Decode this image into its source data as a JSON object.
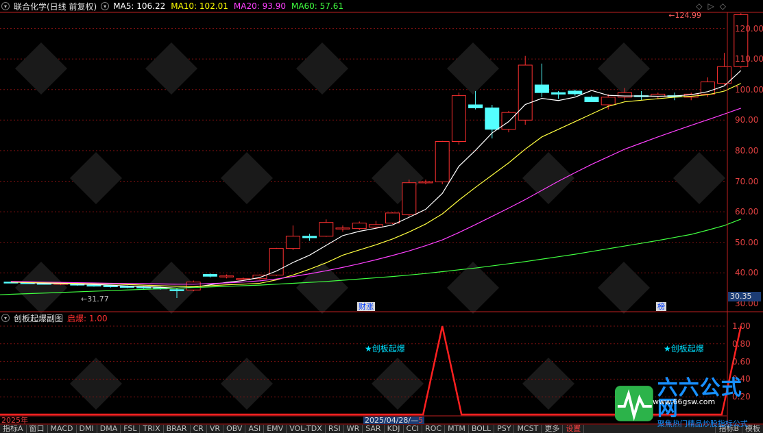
{
  "header": {
    "stock_title": "联合化学(日线 前复权)",
    "ma": [
      {
        "label": "MA5: 106.22",
        "color": "#ffffff"
      },
      {
        "label": "MA10: 102.01",
        "color": "#ffff00"
      },
      {
        "label": "MA20: 93.90",
        "color": "#ff40ff"
      },
      {
        "label": "MA60: 57.61",
        "color": "#40ff40"
      }
    ]
  },
  "controls": {
    "expand": "◇",
    "prev": "▷",
    "settings": "◇"
  },
  "price_axis": {
    "ticks": [
      "120.00",
      "110.00",
      "100.00",
      "90.00",
      "80.00",
      "70.00",
      "60.00",
      "50.00",
      "40.00",
      "30.00"
    ]
  },
  "last_price_label": "124.99",
  "low_price_label": "31.77",
  "current_price": "30.35",
  "event_tags": [
    {
      "label": "财涨"
    },
    {
      "label": "榜"
    }
  ],
  "sub": {
    "title": "创板起爆副图",
    "legend": "启爆: 1.00",
    "ticks": [
      "1.00",
      "0.80",
      "0.60",
      "0.40",
      "0.20"
    ],
    "signal_text": "★创板起爆"
  },
  "date_bar": {
    "year": "2025年",
    "cursor_date": "2025/04/28/—",
    "cursor_suffix": "5"
  },
  "tabs": [
    "指标A",
    "窗口",
    "MACD",
    "DMI",
    "DMA",
    "FSL",
    "TRIX",
    "BRAR",
    "CR",
    "VR",
    "OBV",
    "ASI",
    "EMV",
    "VOL-TDX",
    "RSI",
    "WR",
    "SAR",
    "KDJ",
    "CCI",
    "ROC",
    "MTM",
    "BOLL",
    "PSY",
    "MCST",
    "更多",
    "设置"
  ],
  "tabs_right": [
    "指标B",
    "模板"
  ],
  "logo": {
    "name": "六六公式网",
    "slogan": "聚焦热门精品炒股指标公式",
    "url": "www.66gsw.com"
  },
  "chart_data": {
    "type": "candlestick",
    "candles": [
      [
        37.0,
        37.2,
        36.6,
        36.8
      ],
      [
        36.8,
        37.0,
        36.4,
        36.6
      ],
      [
        36.6,
        36.8,
        36.2,
        36.4
      ],
      [
        36.4,
        36.8,
        36.0,
        36.6
      ],
      [
        36.6,
        36.7,
        35.8,
        36.0
      ],
      [
        36.0,
        36.2,
        35.5,
        35.8
      ],
      [
        35.8,
        36.1,
        35.2,
        35.6
      ],
      [
        35.6,
        35.9,
        35.0,
        35.4
      ],
      [
        35.4,
        35.7,
        34.8,
        35.1
      ],
      [
        35.1,
        35.5,
        34.5,
        35.0
      ],
      [
        34.5,
        35.0,
        31.77,
        34.4
      ],
      [
        34.4,
        37.5,
        34.0,
        37.0
      ],
      [
        39.5,
        39.8,
        38.5,
        38.9
      ],
      [
        38.9,
        39.5,
        38.2,
        39.0
      ],
      [
        38.0,
        38.5,
        37.5,
        38.1
      ],
      [
        38.1,
        39.5,
        37.8,
        39.3
      ],
      [
        39.3,
        48.2,
        39.0,
        48.0
      ],
      [
        48.0,
        55.5,
        47.5,
        52.0
      ],
      [
        52.0,
        52.8,
        50.5,
        51.5
      ],
      [
        52.0,
        57.5,
        51.8,
        56.5
      ],
      [
        54.5,
        55.5,
        53.5,
        54.7
      ],
      [
        54.5,
        56.8,
        54.0,
        56.3
      ],
      [
        55.0,
        57.0,
        54.5,
        55.8
      ],
      [
        56.3,
        59.8,
        56.0,
        59.6
      ],
      [
        59.0,
        70.5,
        58.5,
        69.5
      ],
      [
        69.8,
        70.5,
        69.0,
        69.8
      ],
      [
        69.8,
        83.2,
        69.0,
        83.0
      ],
      [
        83.0,
        99.0,
        82.0,
        98.0
      ],
      [
        95.0,
        99.5,
        93.5,
        94.0
      ],
      [
        94.0,
        95.0,
        84.0,
        87.0
      ],
      [
        87.0,
        93.0,
        86.0,
        92.5
      ],
      [
        90.0,
        111.0,
        88.5,
        108.0
      ],
      [
        101.5,
        108.5,
        97.5,
        99.0
      ],
      [
        99.0,
        99.5,
        97.0,
        98.5
      ],
      [
        99.5,
        100.0,
        98.0,
        98.6
      ],
      [
        97.5,
        98.0,
        96.5,
        96.0
      ],
      [
        95.0,
        98.5,
        93.5,
        97.5
      ],
      [
        97.5,
        100.5,
        96.5,
        99.0
      ],
      [
        98.0,
        99.5,
        96.5,
        97.8
      ],
      [
        97.8,
        99.0,
        96.8,
        98.5
      ],
      [
        98.0,
        99.0,
        96.5,
        97.8
      ],
      [
        97.5,
        99.0,
        96.5,
        98.5
      ],
      [
        98.5,
        104.0,
        97.5,
        102.5
      ],
      [
        102.0,
        112.0,
        101.5,
        107.5
      ],
      [
        107.5,
        124.99,
        107.0,
        124.5
      ]
    ],
    "ma5": [
      37.0,
      36.8,
      36.6,
      36.5,
      36.3,
      36.2,
      36.0,
      35.7,
      35.5,
      35.3,
      35.0,
      35.3,
      36.1,
      36.9,
      37.5,
      38.5,
      40.6,
      43.4,
      45.8,
      49.0,
      52.2,
      53.6,
      54.6,
      55.7,
      58.2,
      60.8,
      66.0,
      74.9,
      80.1,
      85.8,
      89.5,
      95.1,
      97.1,
      96.4,
      97.5,
      99.7,
      98.1,
      97.9,
      97.9,
      97.8,
      97.9,
      98.3,
      99.3,
      101.2,
      106.22
    ],
    "ma10": [
      37.0,
      36.9,
      36.8,
      36.7,
      36.6,
      36.5,
      36.4,
      36.2,
      36.0,
      35.8,
      35.6,
      35.5,
      35.8,
      36.1,
      36.3,
      36.6,
      37.7,
      39.3,
      41.2,
      43.3,
      45.8,
      47.5,
      49.2,
      51.1,
      53.4,
      56.0,
      59.3,
      63.8,
      68.0,
      72.0,
      76.0,
      80.5,
      84.5,
      87.0,
      89.5,
      92.0,
      94.5,
      96.0,
      96.5,
      97.0,
      97.5,
      97.8,
      98.3,
      99.5,
      102.01
    ],
    "ma20": [
      37.2,
      37.1,
      37.0,
      36.9,
      36.8,
      36.7,
      36.6,
      36.5,
      36.5,
      36.4,
      36.3,
      36.3,
      36.5,
      36.7,
      37.0,
      37.4,
      38.0,
      38.8,
      39.7,
      40.7,
      41.8,
      43.0,
      44.3,
      45.7,
      47.2,
      48.9,
      50.8,
      53.2,
      55.8,
      58.5,
      61.2,
      64.0,
      67.0,
      70.0,
      72.8,
      75.5,
      78.0,
      80.5,
      82.5,
      84.5,
      86.4,
      88.3,
      90.1,
      92.0,
      93.9
    ],
    "ma60": [
      33.0,
      33.2,
      33.4,
      33.6,
      33.8,
      34.0,
      34.2,
      34.4,
      34.6,
      34.8,
      35.0,
      35.2,
      35.4,
      35.6,
      35.8,
      36.0,
      36.3,
      36.6,
      36.9,
      37.2,
      37.6,
      38.0,
      38.4,
      38.8,
      39.3,
      39.8,
      40.4,
      41.0,
      41.6,
      42.3,
      43.0,
      43.7,
      44.5,
      45.3,
      46.1,
      47.0,
      47.9,
      48.8,
      49.7,
      50.6,
      51.6,
      52.6,
      54.0,
      55.5,
      57.61
    ],
    "signal": [
      0,
      0,
      0,
      0,
      0,
      0,
      0,
      0,
      0,
      0,
      0,
      0,
      0,
      0,
      0,
      0,
      0,
      0,
      0,
      0,
      0,
      0,
      0,
      0,
      0,
      0,
      1,
      0,
      0,
      0,
      0,
      0,
      0,
      0,
      0,
      0,
      0,
      0,
      0,
      0,
      0,
      0,
      0,
      0,
      1
    ]
  }
}
